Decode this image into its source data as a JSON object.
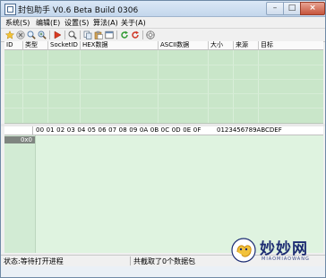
{
  "window": {
    "title": "封包助手 V0.6 Beta Build 0306",
    "controls": {
      "minimize": "–",
      "maximize": "□",
      "close": "×"
    }
  },
  "menu": [
    {
      "label": "系统(S)"
    },
    {
      "label": "编辑(E)"
    },
    {
      "label": "设置(S)"
    },
    {
      "label": "算法(A)"
    },
    {
      "label": "关于(A)"
    }
  ],
  "toolbar": {
    "icons": [
      "star-icon",
      "stop-icon",
      "search-icon",
      "search-plus-icon",
      "play-icon",
      "zoom-icon",
      "copy-icon",
      "paste-icon",
      "window-icon",
      "refresh-green-icon",
      "refresh-red-icon",
      "settings-icon"
    ]
  },
  "packet_list": {
    "columns": [
      "ID",
      "类型",
      "SocketID",
      "HEX数据",
      "ASCII数据",
      "大小",
      "来源",
      "目标"
    ]
  },
  "hex_view": {
    "header_hex": "00 01 02 03 04 05 06 07 08 09 0A 0B 0C 0D 0E 0F",
    "header_ascii": "0123456789ABCDEF",
    "offset_first": "0x0"
  },
  "status": {
    "left": "状态:等待打开进程",
    "right": "共截取了0个数据包"
  },
  "watermark": {
    "text": "妙妙网",
    "sub": "MIAOMIAOWANG"
  },
  "colors": {
    "list_bg": "#c9e6c9",
    "hex_bg": "#dff3e0",
    "watermark": "#1c2c72"
  }
}
